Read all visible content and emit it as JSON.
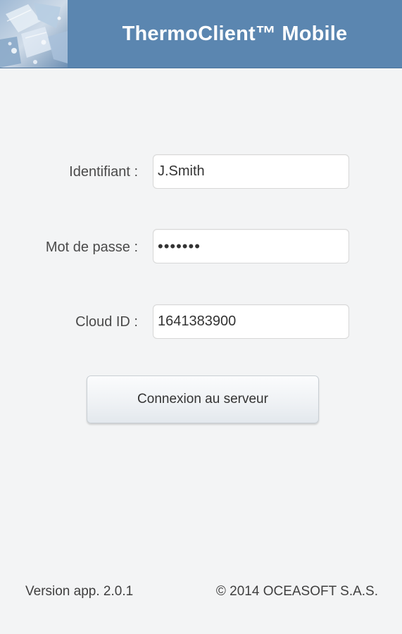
{
  "header": {
    "title": "ThermoClient™ Mobile",
    "image_icon": "ice-cubes-image",
    "background_color": "#5b86b0"
  },
  "form": {
    "identifiant": {
      "label": "Identifiant :",
      "value": "J.Smith"
    },
    "password": {
      "label": "Mot de passe :",
      "value": "1234567"
    },
    "cloud_id": {
      "label": "Cloud ID :",
      "value": "1641383900"
    },
    "connect_button_label": "Connexion au serveur"
  },
  "footer": {
    "version": "Version app. 2.0.1",
    "copyright": "© 2014 OCEASOFT S.A.S."
  }
}
